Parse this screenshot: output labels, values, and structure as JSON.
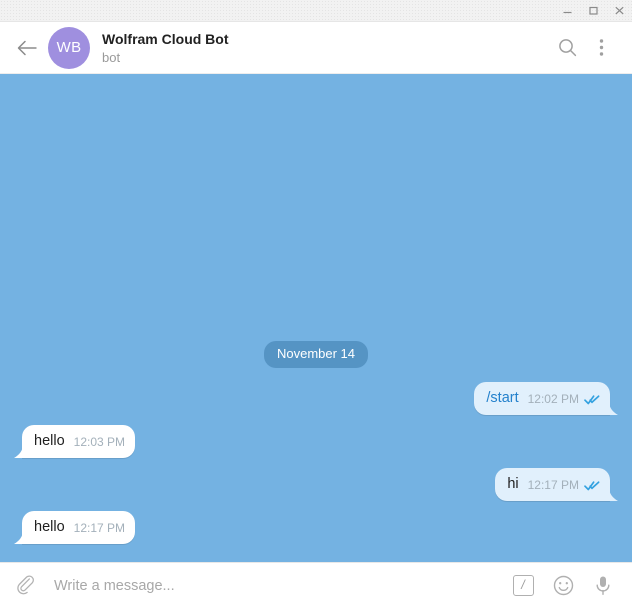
{
  "window": {
    "controls": [
      {
        "name": "minimize",
        "label": "—"
      },
      {
        "name": "maximize",
        "label": "□"
      },
      {
        "name": "close",
        "label": "✕"
      }
    ]
  },
  "header": {
    "back_label": "Back",
    "avatar_initials": "WB",
    "avatar_color": "#9f8fdf",
    "title": "Wolfram Cloud Bot",
    "status": "bot",
    "search_label": "Search",
    "menu_label": "More"
  },
  "chat": {
    "background_color": "#74b2e2",
    "date_divider": "November 14",
    "messages": [
      {
        "id": "m1",
        "direction": "out",
        "text": "/start",
        "is_command": true,
        "time": "12:02 PM",
        "status": "read"
      },
      {
        "id": "m2",
        "direction": "in",
        "text": "hello",
        "is_command": false,
        "time": "12:03 PM",
        "status": ""
      },
      {
        "id": "m3",
        "direction": "out",
        "text": "hi",
        "is_command": false,
        "time": "12:17 PM",
        "status": "read"
      },
      {
        "id": "m4",
        "direction": "in",
        "text": "hello",
        "is_command": false,
        "time": "12:17 PM",
        "status": ""
      }
    ]
  },
  "composer": {
    "attach_label": "Attach file",
    "input_value": "",
    "input_placeholder": "Write a message...",
    "command_label": "/",
    "emoji_label": "Emoji",
    "voice_label": "Voice message"
  }
}
